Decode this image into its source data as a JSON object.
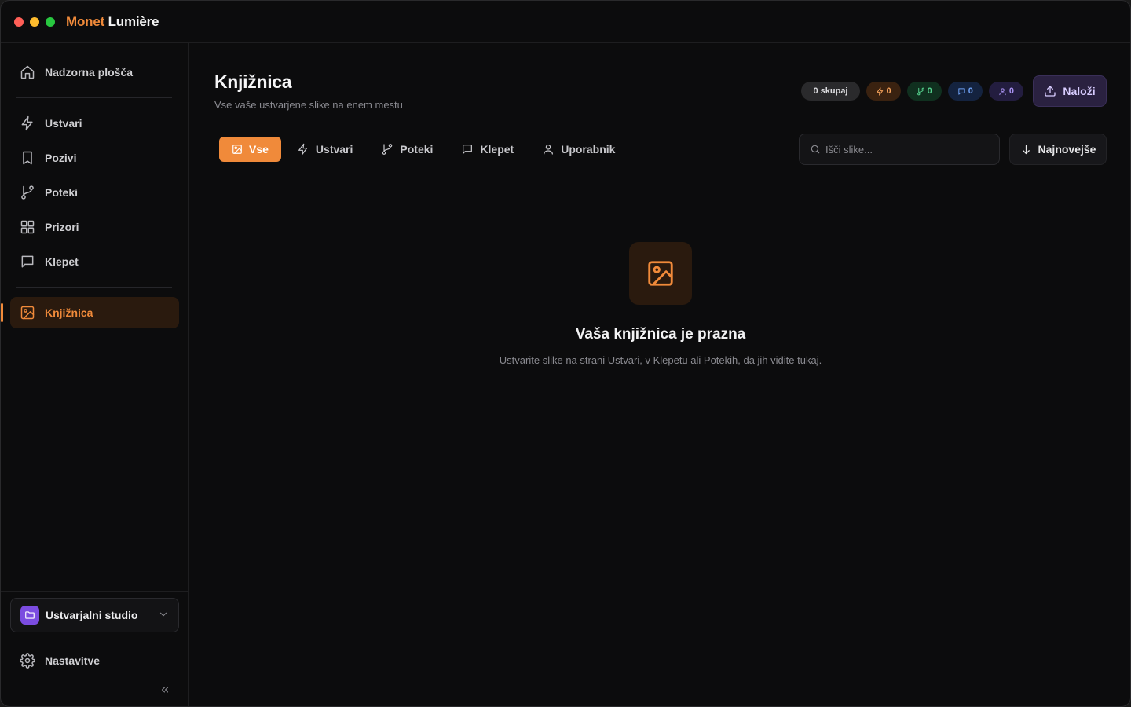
{
  "app": {
    "brand_first": "Monet",
    "brand_second": "Lumière",
    "accent_color": "#f08a3a"
  },
  "sidebar": {
    "items": [
      {
        "label": "Nadzorna plošča",
        "icon": "home-icon"
      },
      {
        "label": "Ustvari",
        "icon": "zap-icon"
      },
      {
        "label": "Pozivi",
        "icon": "bookmark-icon"
      },
      {
        "label": "Poteki",
        "icon": "git-branch-icon"
      },
      {
        "label": "Prizori",
        "icon": "grid-icon"
      },
      {
        "label": "Klepet",
        "icon": "message-square-icon"
      },
      {
        "label": "Knjižnica",
        "icon": "image-icon",
        "active": true
      }
    ],
    "workspace": "Ustvarjalni studio",
    "settings": "Nastavitve"
  },
  "header": {
    "title": "Knjižnica",
    "subtitle": "Vse vaše ustvarjene slike na enem mestu",
    "badges": {
      "total": "0 skupaj",
      "create": "0",
      "flow": "0",
      "chat": "0",
      "user": "0"
    },
    "upload_label": "Naloži"
  },
  "filters": {
    "tabs": [
      {
        "label": "Vse",
        "icon": "image-icon",
        "active": true
      },
      {
        "label": "Ustvari",
        "icon": "zap-icon"
      },
      {
        "label": "Poteki",
        "icon": "git-branch-icon"
      },
      {
        "label": "Klepet",
        "icon": "message-square-icon"
      },
      {
        "label": "Uporabnik",
        "icon": "user-icon"
      }
    ],
    "search_placeholder": "Išči slike...",
    "sort_label": "Najnovejše"
  },
  "empty_state": {
    "title": "Vaša knjižnica je prazna",
    "message": "Ustvarite slike na strani Ustvari, v Klepetu ali Potekih, da jih vidite tukaj."
  }
}
